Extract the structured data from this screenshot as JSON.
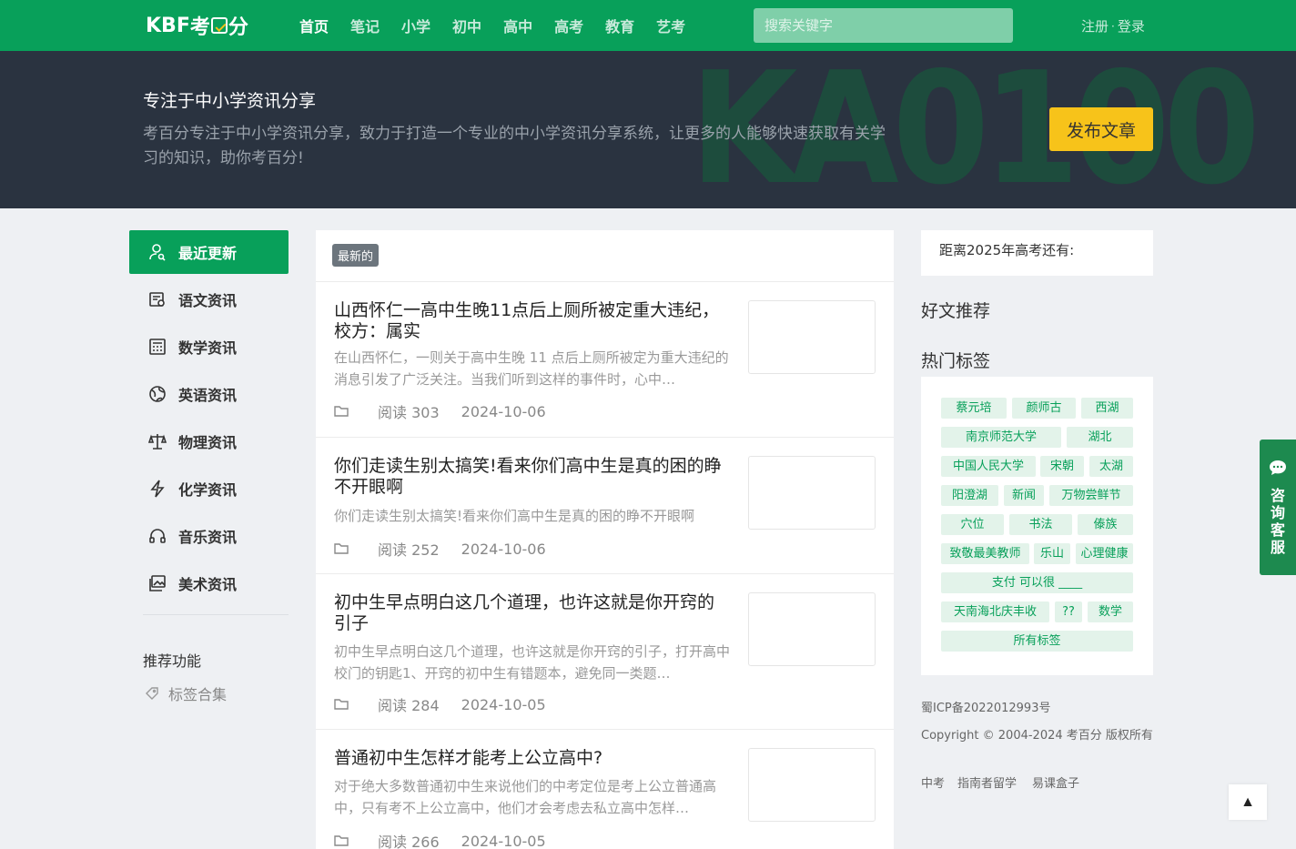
{
  "brand": {
    "logo_text_left": "KBF",
    "logo_text_mid": "考",
    "logo_text_right": "分"
  },
  "nav": {
    "items": [
      "首页",
      "笔记",
      "小学",
      "初中",
      "高中",
      "高考",
      "教育",
      "艺考"
    ]
  },
  "search": {
    "placeholder": "搜索关键字"
  },
  "auth": {
    "register": "注册",
    "separator": "·",
    "login": "登录"
  },
  "hero": {
    "bg_text": "KA0100",
    "title": "专注于中小学资讯分享",
    "description": "考百分专注于中小学资讯分享，致力于打造一个专业的中小学资讯分享系统，让更多的人能够快速获取有关学习的知识，助你考百分!",
    "publish_label": "发布文章"
  },
  "sidebar": {
    "items": [
      {
        "label": "最近更新",
        "icon": "user-icon"
      },
      {
        "label": "语文资讯",
        "icon": "book-icon"
      },
      {
        "label": "数学资讯",
        "icon": "calculator-icon"
      },
      {
        "label": "英语资讯",
        "icon": "globe-icon"
      },
      {
        "label": "物理资讯",
        "icon": "scale-icon"
      },
      {
        "label": "化学资讯",
        "icon": "lightning-icon"
      },
      {
        "label": "音乐资讯",
        "icon": "headphones-icon"
      },
      {
        "label": "美术资讯",
        "icon": "image-icon"
      }
    ],
    "recommend_title": "推荐功能",
    "recommend_link": "标签合集"
  },
  "main": {
    "badge": "最新的",
    "articles": [
      {
        "title": "山西怀仁一高中生晚11点后上厕所被定重大违纪，校方：属实",
        "summary": "在山西怀仁，一则关于高中生晚 11 点后上厕所被定为重大违纪的消息引发了广泛关注。当我们听到这样的事件时，心中…",
        "reads": "阅读 303",
        "date": "2024-10-06"
      },
      {
        "title": "你们走读生别太搞笑!看来你们高中生是真的困的睁不开眼啊",
        "summary": "你们走读生别太搞笑!看来你们高中生是真的困的睁不开眼啊",
        "reads": "阅读 252",
        "date": "2024-10-06"
      },
      {
        "title": "初中生早点明白这几个道理，也许这就是你开窍的引子",
        "summary": "初中生早点明白这几个道理，也许这就是你开窍的引子，打开高中校门的钥匙1、开窍的初中生有错题本，避免同一类题…",
        "reads": "阅读 284",
        "date": "2024-10-05"
      },
      {
        "title": "普通初中生怎样才能考上公立高中?",
        "summary": "对于绝大多数普通初中生来说他们的中考定位是考上公立普通高中，只有考不上公立高中，他们才会考虑去私立高中怎样…",
        "reads": "阅读 266",
        "date": "2024-10-05"
      }
    ]
  },
  "right": {
    "countdown": "距离2025年高考还有:",
    "good_articles": "好文推荐",
    "hot_tags": "热门标签",
    "tags": [
      "蔡元培",
      "颜师古",
      "西湖",
      "南京师范大学",
      "湖北",
      "中国人民大学",
      "宋朝",
      "太湖",
      "阳澄湖",
      "新闻",
      "万物尝鲜节",
      "穴位",
      "书法",
      "傣族",
      "致敬最美教师",
      "乐山",
      "心理健康",
      "支付 可以很 ____",
      "天南海北庆丰收",
      "??",
      "数学",
      "所有标签"
    ],
    "icp": "蜀ICP备2022012993号",
    "copyright": "Copyright © 2004-2024 考百分 版权所有",
    "links": [
      "中考",
      "指南者留学",
      "易课盒子"
    ]
  },
  "float": {
    "service_chars": [
      "咨",
      "询",
      "客",
      "服"
    ],
    "totop": "▲"
  }
}
